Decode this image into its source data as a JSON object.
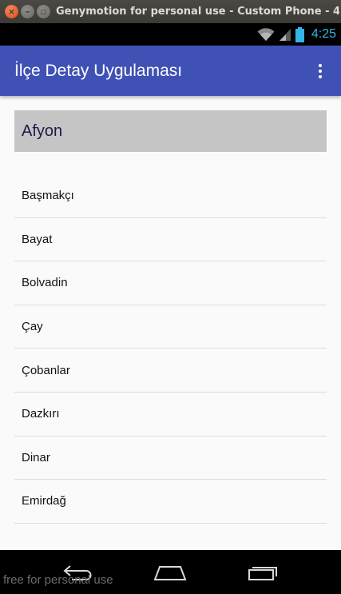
{
  "window": {
    "title": "Genymotion for personal use - Custom Phone - 4"
  },
  "status_bar": {
    "time": "4:25",
    "icons": [
      "wifi-icon",
      "signal-icon",
      "battery-icon"
    ],
    "accent_color": "#33b5e5"
  },
  "app_bar": {
    "title": "İlçe Detay Uygulaması",
    "color": "#3f51b5",
    "menu_icon": "overflow-menu-icon"
  },
  "header": {
    "city": "Afyon"
  },
  "districts": [
    {
      "label": "Başmakçı"
    },
    {
      "label": "Bayat"
    },
    {
      "label": "Bolvadin"
    },
    {
      "label": "Çay"
    },
    {
      "label": "Çobanlar"
    },
    {
      "label": "Dazkırı"
    },
    {
      "label": "Dinar"
    },
    {
      "label": "Emirdağ"
    }
  ],
  "nav_bar": {
    "icons": [
      "back-icon",
      "home-icon",
      "recents-icon"
    ]
  },
  "watermark": "free for personal use"
}
